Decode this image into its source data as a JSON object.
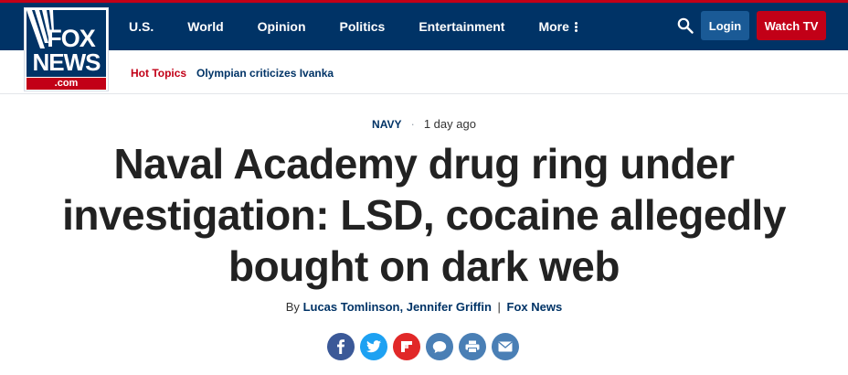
{
  "colors": {
    "navy": "#003366",
    "red": "#c20017",
    "login_blue": "#1a5a96"
  },
  "logo": {
    "line1": "FOX",
    "line2": "NEWS",
    "domain": ".com"
  },
  "nav": {
    "items": [
      "U.S.",
      "World",
      "Opinion",
      "Politics",
      "Entertainment"
    ],
    "more_label": "More",
    "search_icon": "search-icon",
    "login_label": "Login",
    "watch_label": "Watch TV"
  },
  "hot_topics": {
    "label": "Hot Topics",
    "items": [
      "Olympian criticizes Ivanka"
    ]
  },
  "article": {
    "category": "NAVY",
    "separator": "·",
    "time": "1 day ago",
    "headline": "Naval Academy drug ring under investigation: LSD, cocaine allegedly bought on dark web",
    "byline": {
      "prefix": "By",
      "authors": "Lucas Tomlinson, Jennifer Griffin",
      "pipe": "|",
      "source": "Fox News"
    }
  },
  "share": [
    "facebook-icon",
    "twitter-icon",
    "flipboard-icon",
    "comment-icon",
    "print-icon",
    "email-icon"
  ]
}
